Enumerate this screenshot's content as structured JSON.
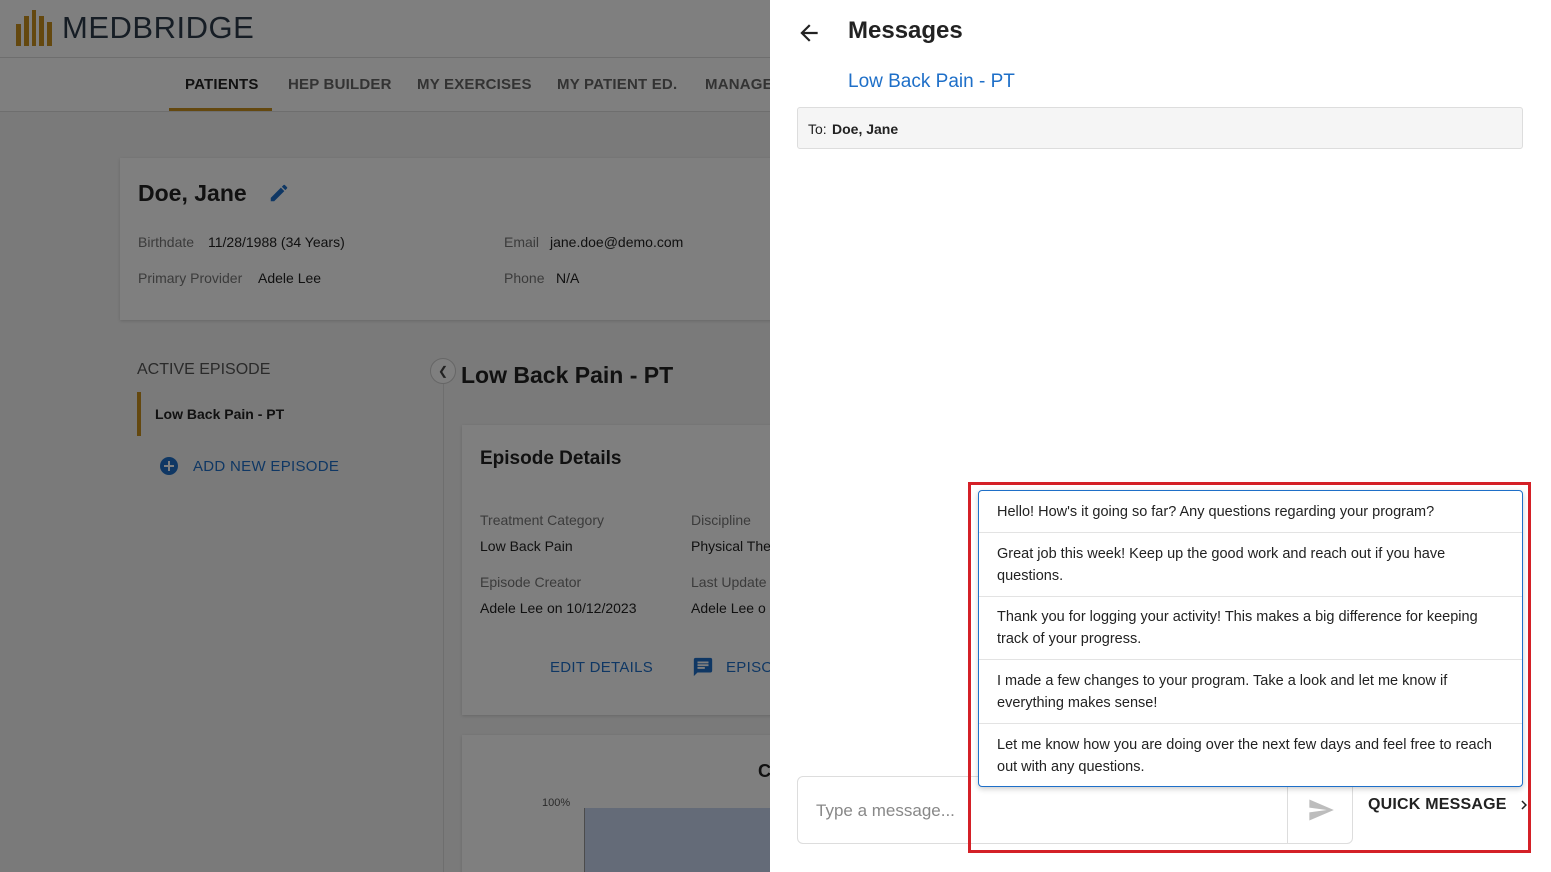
{
  "app": {
    "brand": "MEDBRIDGE",
    "nav": [
      "PATIENTS",
      "HEP BUILDER",
      "MY EXERCISES",
      "MY PATIENT ED.",
      "MANAGE"
    ],
    "active_nav": "PATIENTS",
    "colors": {
      "accent": "#c8901e",
      "link": "#1e6fc8"
    }
  },
  "patient": {
    "name": "Doe, Jane",
    "birthdate_label": "Birthdate",
    "birthdate": "11/28/1988 (34 Years)",
    "provider_label": "Primary Provider",
    "provider": "Adele Lee",
    "email_label": "Email",
    "email": "jane.doe@demo.com",
    "phone_label": "Phone",
    "phone": "N/A"
  },
  "episodes": {
    "section_label": "ACTIVE EPISODE",
    "active": "Low Back Pain - PT",
    "add_label": "ADD NEW EPISODE"
  },
  "episode_view": {
    "title": "Low Back Pain - PT",
    "details_title": "Episode Details",
    "treatment_category_label": "Treatment Category",
    "treatment_category": "Low Back Pain",
    "discipline_label": "Discipline",
    "discipline": "Physical The",
    "creator_label": "Episode Creator",
    "creator": "Adele Lee on 10/12/2023",
    "last_updated_label": "Last Update",
    "last_updated": "Adele Lee o",
    "edit_details": "EDIT DETAILS",
    "episode_btn": "EPISO",
    "chart_letter": "C",
    "chart_ytick": "100%"
  },
  "messages": {
    "title": "Messages",
    "episode_link": "Low Back Pain - PT",
    "to_prefix": "To:",
    "to_name": "Doe, Jane",
    "input_placeholder": "Type a message...",
    "quick_label": "QUICK MESSAGE",
    "quick_messages": [
      "Hello! How's it going so far? Any questions regarding your program?",
      "Great job this week! Keep up the good work and reach out if you have questions.",
      "Thank you for logging your activity! This makes a big difference for keeping track of your progress.",
      "I made a few changes to your program. Take a look and let me know if everything makes sense!",
      "Let me know how you are doing over the next few days and feel free to reach out with any questions."
    ]
  }
}
